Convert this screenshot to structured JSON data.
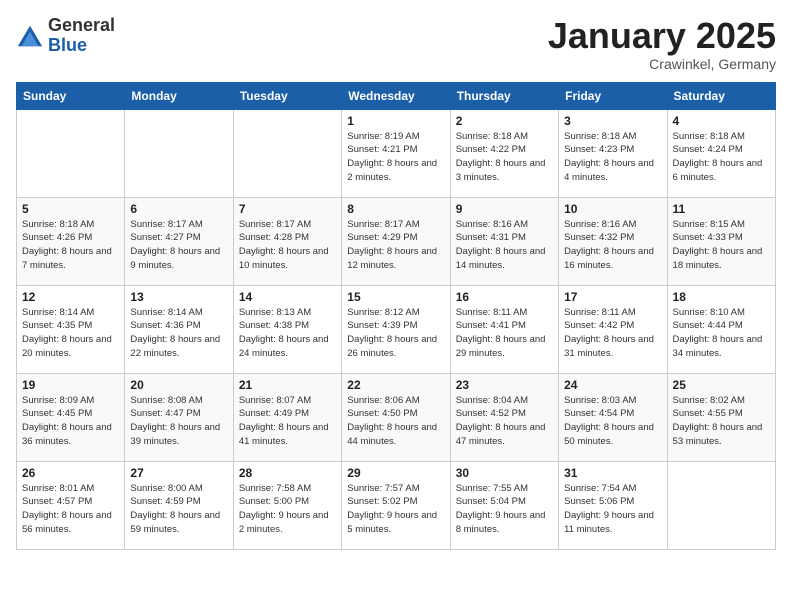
{
  "header": {
    "logo": {
      "general": "General",
      "blue": "Blue"
    },
    "title": "January 2025",
    "location": "Crawinkel, Germany"
  },
  "weekdays": [
    "Sunday",
    "Monday",
    "Tuesday",
    "Wednesday",
    "Thursday",
    "Friday",
    "Saturday"
  ],
  "weeks": [
    [
      {
        "day": "",
        "info": ""
      },
      {
        "day": "",
        "info": ""
      },
      {
        "day": "",
        "info": ""
      },
      {
        "day": "1",
        "info": "Sunrise: 8:19 AM\nSunset: 4:21 PM\nDaylight: 8 hours\nand 2 minutes."
      },
      {
        "day": "2",
        "info": "Sunrise: 8:18 AM\nSunset: 4:22 PM\nDaylight: 8 hours\nand 3 minutes."
      },
      {
        "day": "3",
        "info": "Sunrise: 8:18 AM\nSunset: 4:23 PM\nDaylight: 8 hours\nand 4 minutes."
      },
      {
        "day": "4",
        "info": "Sunrise: 8:18 AM\nSunset: 4:24 PM\nDaylight: 8 hours\nand 6 minutes."
      }
    ],
    [
      {
        "day": "5",
        "info": "Sunrise: 8:18 AM\nSunset: 4:26 PM\nDaylight: 8 hours\nand 7 minutes."
      },
      {
        "day": "6",
        "info": "Sunrise: 8:17 AM\nSunset: 4:27 PM\nDaylight: 8 hours\nand 9 minutes."
      },
      {
        "day": "7",
        "info": "Sunrise: 8:17 AM\nSunset: 4:28 PM\nDaylight: 8 hours\nand 10 minutes."
      },
      {
        "day": "8",
        "info": "Sunrise: 8:17 AM\nSunset: 4:29 PM\nDaylight: 8 hours\nand 12 minutes."
      },
      {
        "day": "9",
        "info": "Sunrise: 8:16 AM\nSunset: 4:31 PM\nDaylight: 8 hours\nand 14 minutes."
      },
      {
        "day": "10",
        "info": "Sunrise: 8:16 AM\nSunset: 4:32 PM\nDaylight: 8 hours\nand 16 minutes."
      },
      {
        "day": "11",
        "info": "Sunrise: 8:15 AM\nSunset: 4:33 PM\nDaylight: 8 hours\nand 18 minutes."
      }
    ],
    [
      {
        "day": "12",
        "info": "Sunrise: 8:14 AM\nSunset: 4:35 PM\nDaylight: 8 hours\nand 20 minutes."
      },
      {
        "day": "13",
        "info": "Sunrise: 8:14 AM\nSunset: 4:36 PM\nDaylight: 8 hours\nand 22 minutes."
      },
      {
        "day": "14",
        "info": "Sunrise: 8:13 AM\nSunset: 4:38 PM\nDaylight: 8 hours\nand 24 minutes."
      },
      {
        "day": "15",
        "info": "Sunrise: 8:12 AM\nSunset: 4:39 PM\nDaylight: 8 hours\nand 26 minutes."
      },
      {
        "day": "16",
        "info": "Sunrise: 8:11 AM\nSunset: 4:41 PM\nDaylight: 8 hours\nand 29 minutes."
      },
      {
        "day": "17",
        "info": "Sunrise: 8:11 AM\nSunset: 4:42 PM\nDaylight: 8 hours\nand 31 minutes."
      },
      {
        "day": "18",
        "info": "Sunrise: 8:10 AM\nSunset: 4:44 PM\nDaylight: 8 hours\nand 34 minutes."
      }
    ],
    [
      {
        "day": "19",
        "info": "Sunrise: 8:09 AM\nSunset: 4:45 PM\nDaylight: 8 hours\nand 36 minutes."
      },
      {
        "day": "20",
        "info": "Sunrise: 8:08 AM\nSunset: 4:47 PM\nDaylight: 8 hours\nand 39 minutes."
      },
      {
        "day": "21",
        "info": "Sunrise: 8:07 AM\nSunset: 4:49 PM\nDaylight: 8 hours\nand 41 minutes."
      },
      {
        "day": "22",
        "info": "Sunrise: 8:06 AM\nSunset: 4:50 PM\nDaylight: 8 hours\nand 44 minutes."
      },
      {
        "day": "23",
        "info": "Sunrise: 8:04 AM\nSunset: 4:52 PM\nDaylight: 8 hours\nand 47 minutes."
      },
      {
        "day": "24",
        "info": "Sunrise: 8:03 AM\nSunset: 4:54 PM\nDaylight: 8 hours\nand 50 minutes."
      },
      {
        "day": "25",
        "info": "Sunrise: 8:02 AM\nSunset: 4:55 PM\nDaylight: 8 hours\nand 53 minutes."
      }
    ],
    [
      {
        "day": "26",
        "info": "Sunrise: 8:01 AM\nSunset: 4:57 PM\nDaylight: 8 hours\nand 56 minutes."
      },
      {
        "day": "27",
        "info": "Sunrise: 8:00 AM\nSunset: 4:59 PM\nDaylight: 8 hours\nand 59 minutes."
      },
      {
        "day": "28",
        "info": "Sunrise: 7:58 AM\nSunset: 5:00 PM\nDaylight: 9 hours\nand 2 minutes."
      },
      {
        "day": "29",
        "info": "Sunrise: 7:57 AM\nSunset: 5:02 PM\nDaylight: 9 hours\nand 5 minutes."
      },
      {
        "day": "30",
        "info": "Sunrise: 7:55 AM\nSunset: 5:04 PM\nDaylight: 9 hours\nand 8 minutes."
      },
      {
        "day": "31",
        "info": "Sunrise: 7:54 AM\nSunset: 5:06 PM\nDaylight: 9 hours\nand 11 minutes."
      },
      {
        "day": "",
        "info": ""
      }
    ]
  ]
}
